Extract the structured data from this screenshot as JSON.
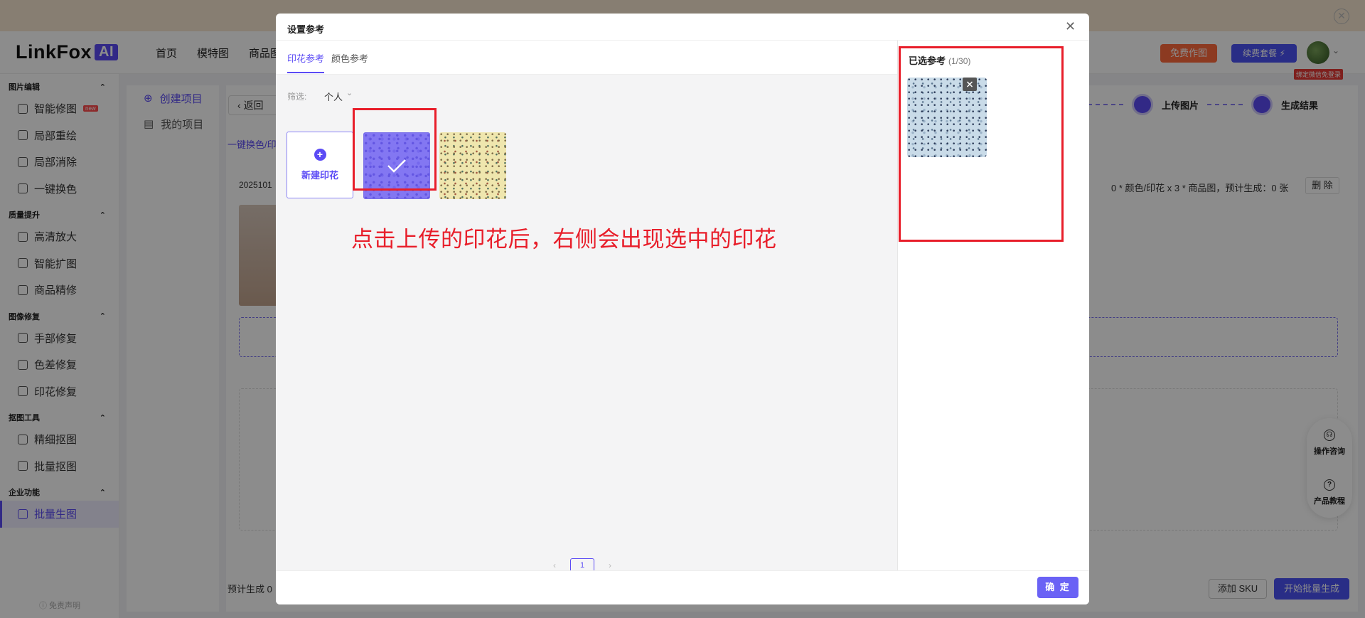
{
  "app": {
    "logo_text": "LinkFox",
    "logo_badge": "AI",
    "nav": [
      "首页",
      "模特图",
      "商品图"
    ],
    "free_button": "免费作图",
    "renew_button": "续费套餐 ⚡",
    "bind_tag": "绑定微信免登录"
  },
  "sidebar": {
    "groups": [
      {
        "title": "图片编辑",
        "items": [
          {
            "label": "智能修图",
            "badge": "new"
          },
          {
            "label": "局部重绘"
          },
          {
            "label": "局部消除"
          },
          {
            "label": "一键换色"
          }
        ]
      },
      {
        "title": "质量提升",
        "items": [
          {
            "label": "高清放大"
          },
          {
            "label": "智能扩图"
          },
          {
            "label": "商品精修"
          }
        ]
      },
      {
        "title": "图像修复",
        "items": [
          {
            "label": "手部修复"
          },
          {
            "label": "色差修复"
          },
          {
            "label": "印花修复"
          }
        ]
      },
      {
        "title": "抠图工具",
        "items": [
          {
            "label": "精细抠图"
          },
          {
            "label": "批量抠图"
          }
        ]
      },
      {
        "title": "企业功能",
        "items": [
          {
            "label": "批量生图",
            "active": true
          }
        ]
      }
    ],
    "footer": "ⓘ 免责声明"
  },
  "subnav": {
    "create": "创建项目",
    "mine": "我的项目"
  },
  "content": {
    "back": "返回",
    "ribbon": "一键换色/印",
    "job_id": "2025101",
    "steps": [
      "上传图片",
      "生成结果"
    ],
    "summary": "0 * 颜色/印花 x 3 * 商品图，预计生成：0 张",
    "delete": "删 除",
    "estimate": "预计生成 0",
    "add_sku": "添加 SKU",
    "start_batch": "开始批量生成"
  },
  "float_help": {
    "consult": "操作咨询",
    "tutorial": "产品教程"
  },
  "modal": {
    "title": "设置参考",
    "tabs": [
      "印花参考",
      "颜色参考"
    ],
    "filter_label": "筛选:",
    "filter_value": "个人",
    "new_print": "新建印花",
    "annotation": "点击上传的印花后，右侧会出现选中的印花",
    "page": "1",
    "selected_title": "已选参考",
    "selected_count": "(1/30)",
    "confirm": "确 定"
  },
  "colors": {
    "accent": "#5b4bf5",
    "annotation_red": "#e81e2a"
  }
}
